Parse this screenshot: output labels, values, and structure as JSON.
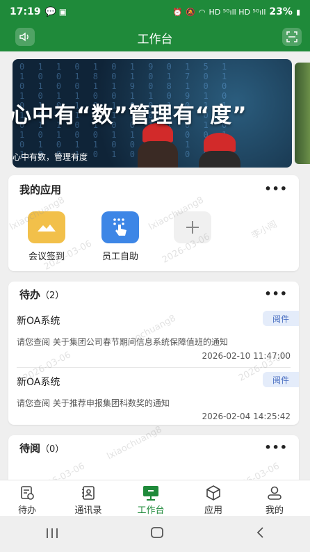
{
  "status_bar": {
    "time": "17:19",
    "indicators": "HD ⁵ᴳıll HD ⁵ᴳıll",
    "battery": "23%"
  },
  "header": {
    "title": "工作台",
    "left_icon": "speaker-icon",
    "right_icon": "scan-icon"
  },
  "banner": {
    "title": "心中有“数”管理有“度”",
    "subtitle": "心中有数，管理有度"
  },
  "my_apps": {
    "title": "我的应用",
    "more": "•••",
    "apps": [
      {
        "label": "会议签到",
        "icon": "meeting-checkin-icon",
        "color": "#f2c04a"
      },
      {
        "label": "员工自助",
        "icon": "tap-hand-icon",
        "color": "#3d86e6"
      }
    ],
    "add_icon": "plus-icon"
  },
  "todo": {
    "title": "待办",
    "count": "（2）",
    "more": "•••",
    "items": [
      {
        "source": "新OA系统",
        "tag": "阅件",
        "desc": "请您查阅 关于集团公司春节期间信息系统保障值班的通知",
        "time": "2026-02-10 11:47:00"
      },
      {
        "source": "新OA系统",
        "tag": "阅件",
        "desc": "请您查阅 关于推荐申报集团科数奖的通知",
        "time": "2026-02-04 14:25:42"
      }
    ]
  },
  "to_read": {
    "title": "待阅",
    "count": "（0）",
    "more": "•••"
  },
  "tabbar": {
    "tabs": [
      {
        "label": "待办",
        "icon": "todo-icon"
      },
      {
        "label": "通讯录",
        "icon": "contacts-icon"
      },
      {
        "label": "工作台",
        "icon": "workbench-icon",
        "active": true
      },
      {
        "label": "应用",
        "icon": "apps-icon"
      },
      {
        "label": "我的",
        "icon": "profile-icon"
      }
    ],
    "active_color": "#1f8a3a"
  },
  "watermark": {
    "user": "lxiaochuang8",
    "name": "李小闯",
    "date": "2026-03-06"
  },
  "theme": {
    "primary": "#1f8a3a"
  }
}
